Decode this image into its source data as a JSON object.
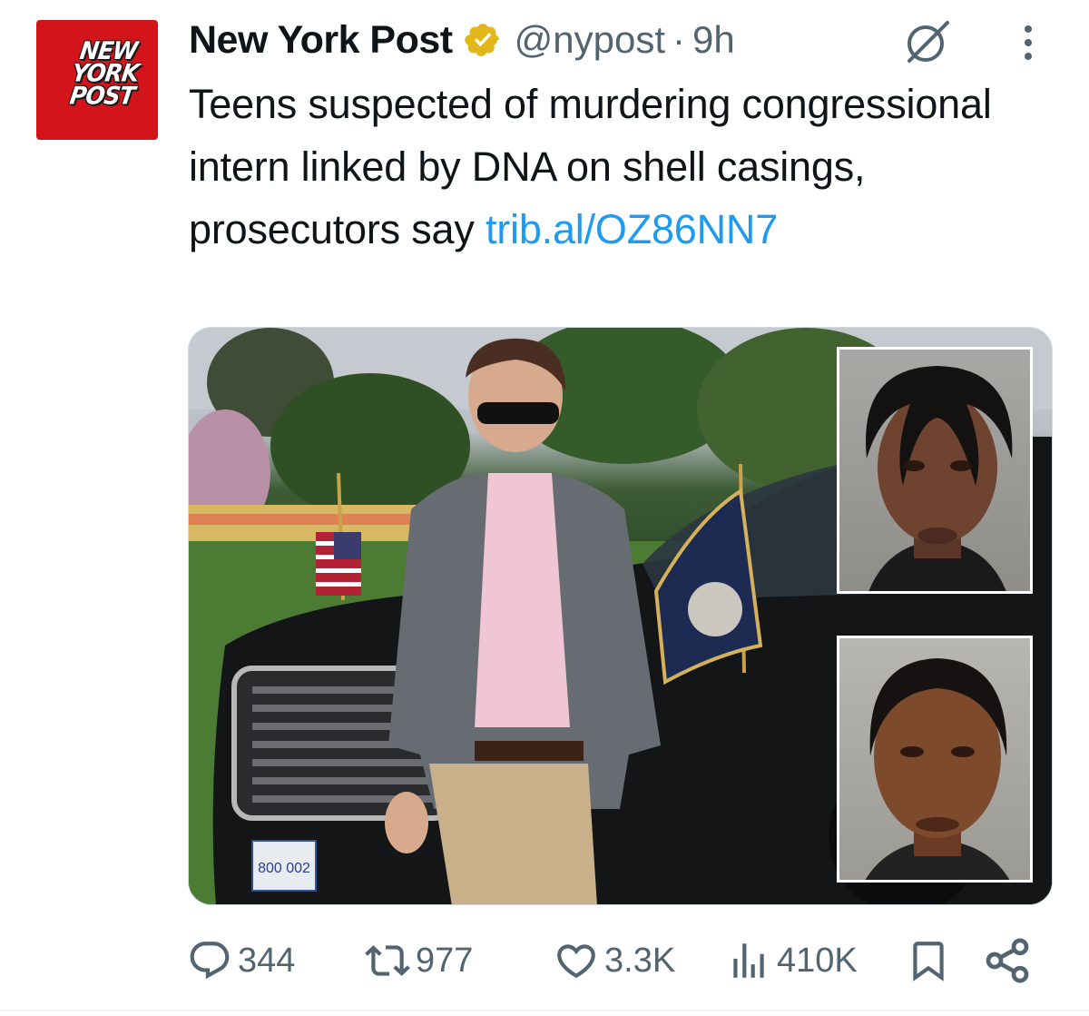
{
  "author": {
    "display_name": "New York Post",
    "handle": "@nypost",
    "separator": "·",
    "time": "9h",
    "verified": true,
    "badge_color": "#e2b719",
    "avatar_logo_text": "NEW YORK POST",
    "avatar_color": "#d3141b"
  },
  "tweet": {
    "text": "Teens suspected of murdering congressional intern linked by DNA on shell casings, prosecutors say ",
    "link": "trib.al/OZ86NN7",
    "link_color": "#1d9bf0"
  },
  "media": {
    "kind": "photo-collage",
    "panels": [
      "main-photo",
      "mugshot-top",
      "mugshot-bottom"
    ],
    "plate_text": "800 002"
  },
  "actions": {
    "reply_count": "344",
    "retweet_count": "977",
    "like_count": "3.3K",
    "view_count": "410K",
    "icon_color": "#536471"
  },
  "icons": [
    "verified-badge-icon",
    "grok-icon",
    "more-icon",
    "reply-icon",
    "retweet-icon",
    "like-icon",
    "views-icon",
    "bookmark-icon",
    "share-icon"
  ]
}
